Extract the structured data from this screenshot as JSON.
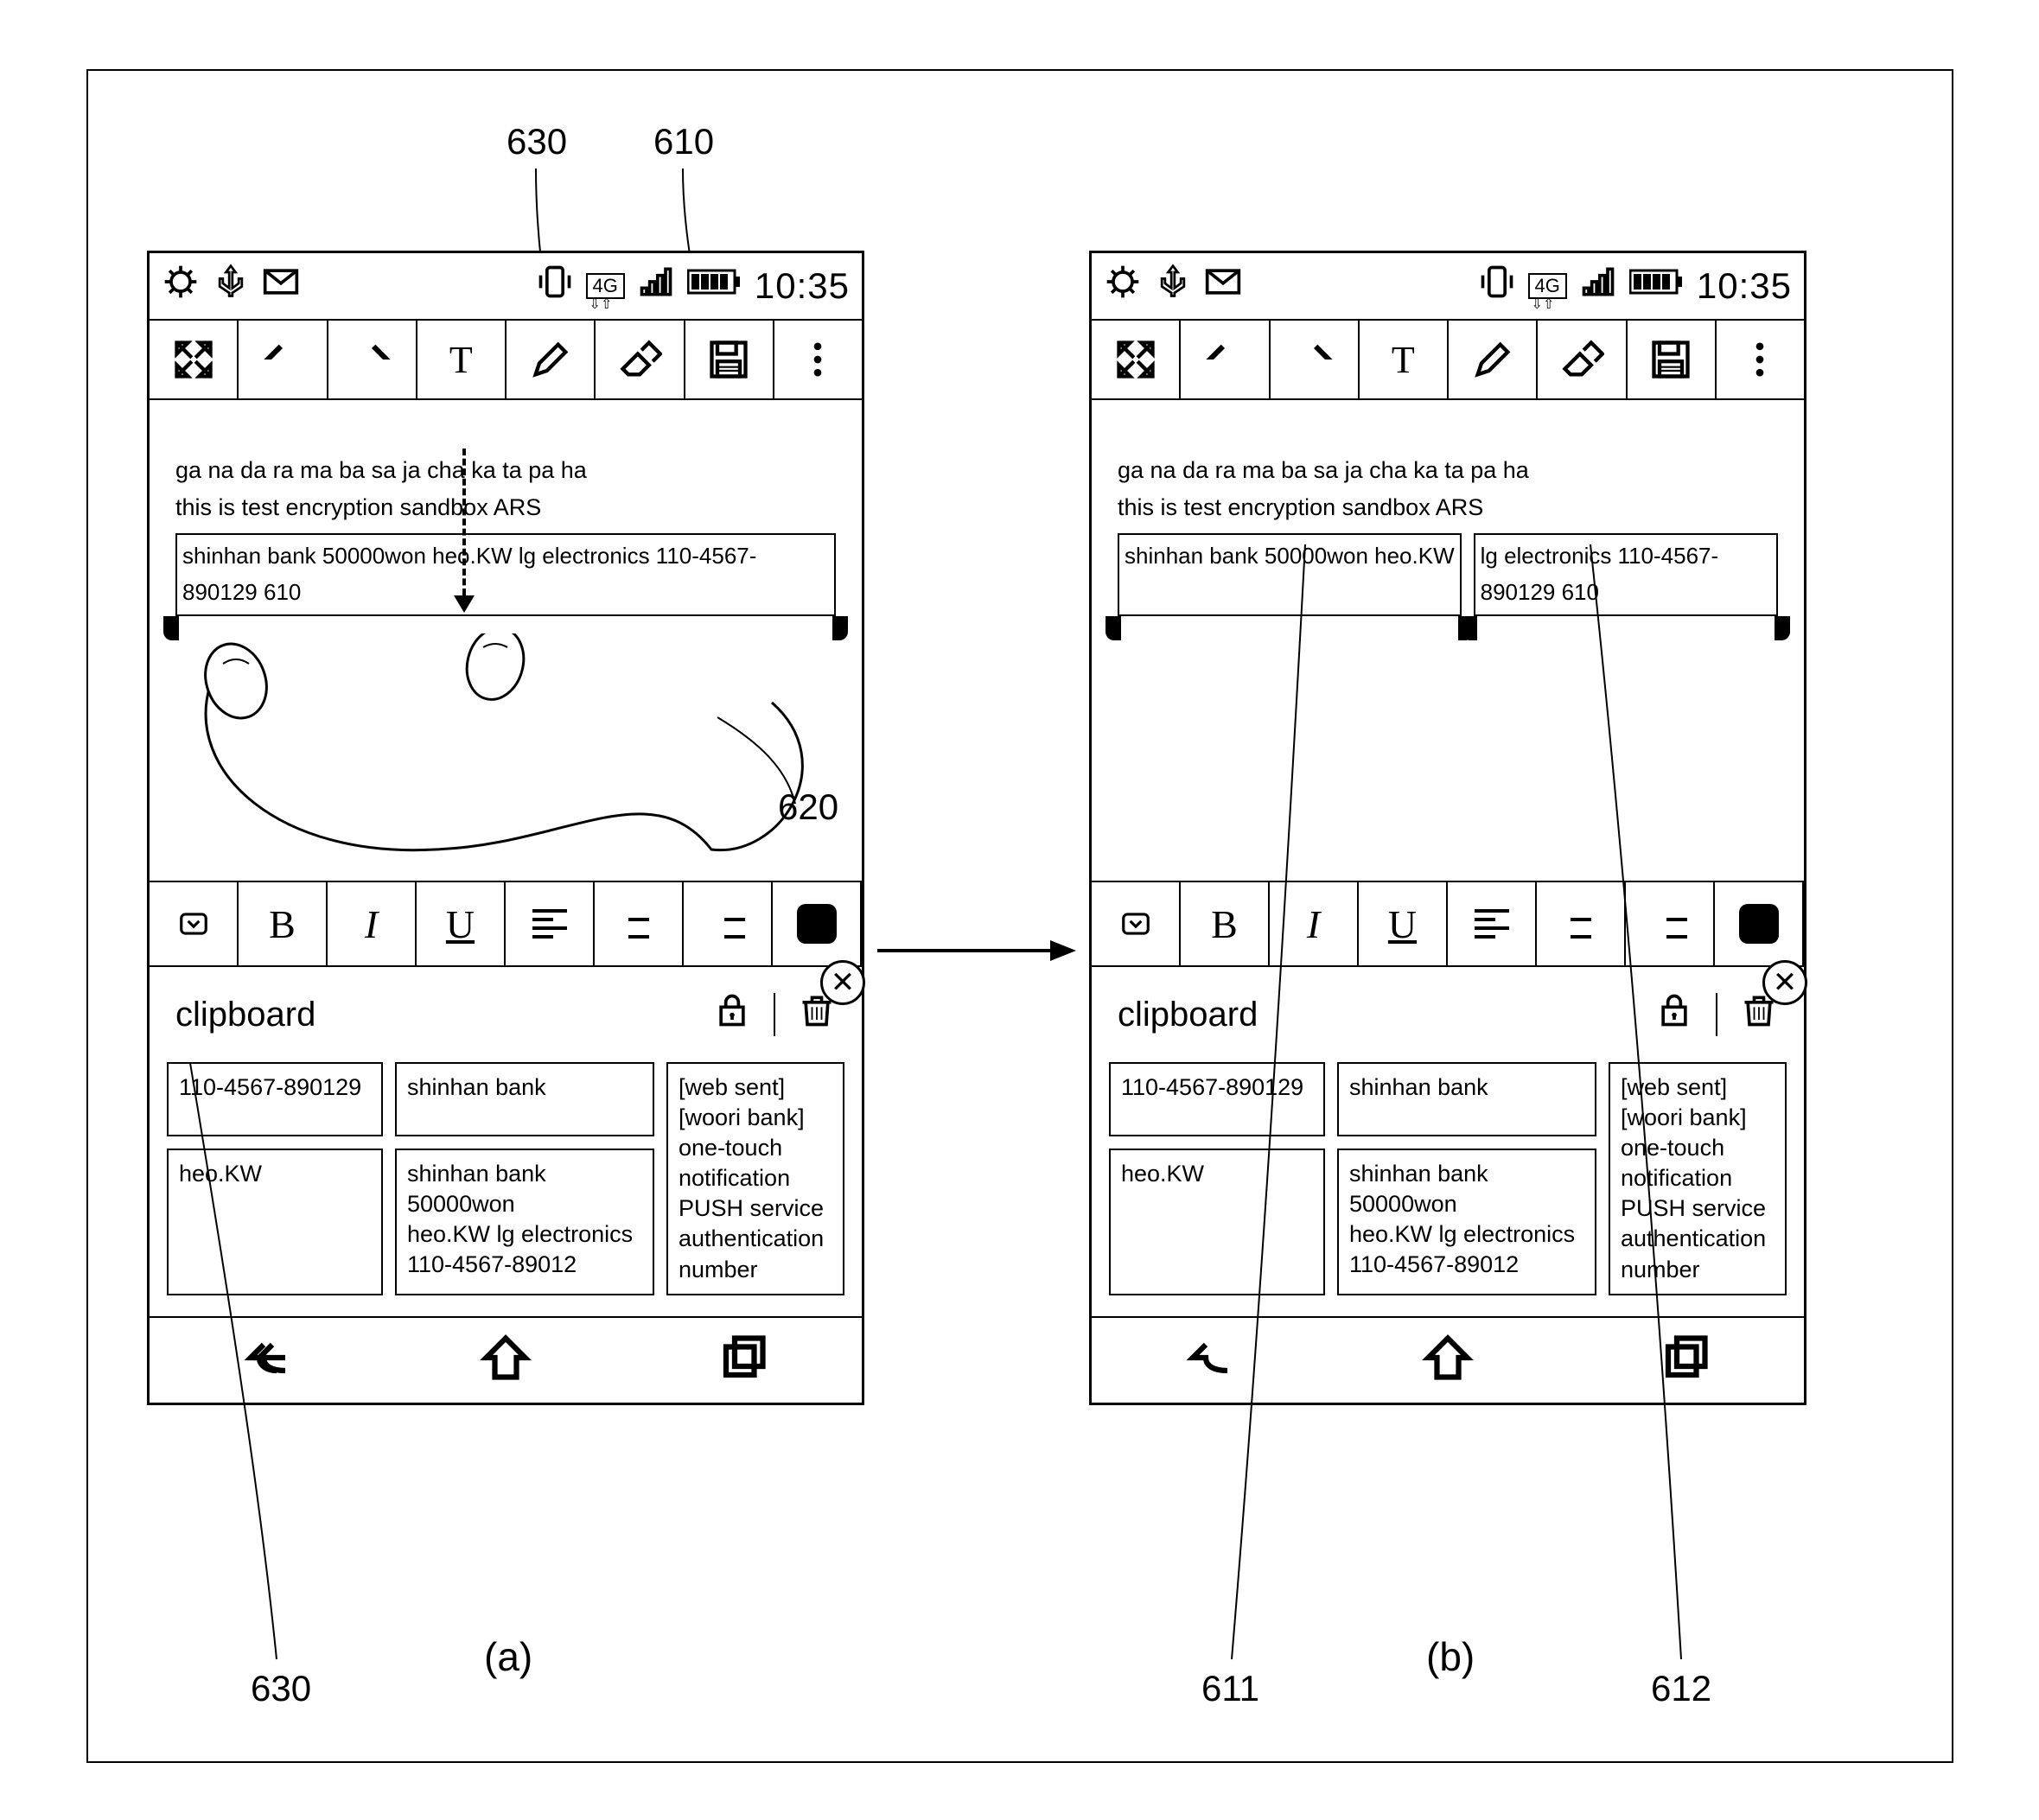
{
  "status": {
    "time": "10:35",
    "net_label": "4G"
  },
  "content": {
    "line1": "ga na da ra ma ba sa ja cha ka ta pa ha",
    "line2": "this is test encryption sandbox ARS",
    "sel_full": "shinhan bank 50000won heo.KW lg electronics 110-4567-890129 610",
    "sel_left": "shinhan bank 50000won heo.KW",
    "sel_right": "lg electronics 110-4567-890129 610"
  },
  "fmt": {
    "b": "B",
    "i": "I",
    "u": "U"
  },
  "clipboard": {
    "title": "clipboard",
    "items": [
      "110-4567-890129",
      "shinhan bank",
      "[web sent]\n[woori bank]\none-touch notification\nPUSH service\nauthentication number",
      "heo.KW",
      "shinhan bank 50000won\nheo.KW lg electronics\n110-4567-89012"
    ]
  },
  "labels": {
    "top_630": "630",
    "top_610": "610",
    "gesture_620": "620",
    "bottom_630": "630",
    "fig_a": "(a)",
    "fig_b": "(b)",
    "b_611": "611",
    "b_612": "612"
  },
  "toolbar": {
    "t": "T"
  }
}
